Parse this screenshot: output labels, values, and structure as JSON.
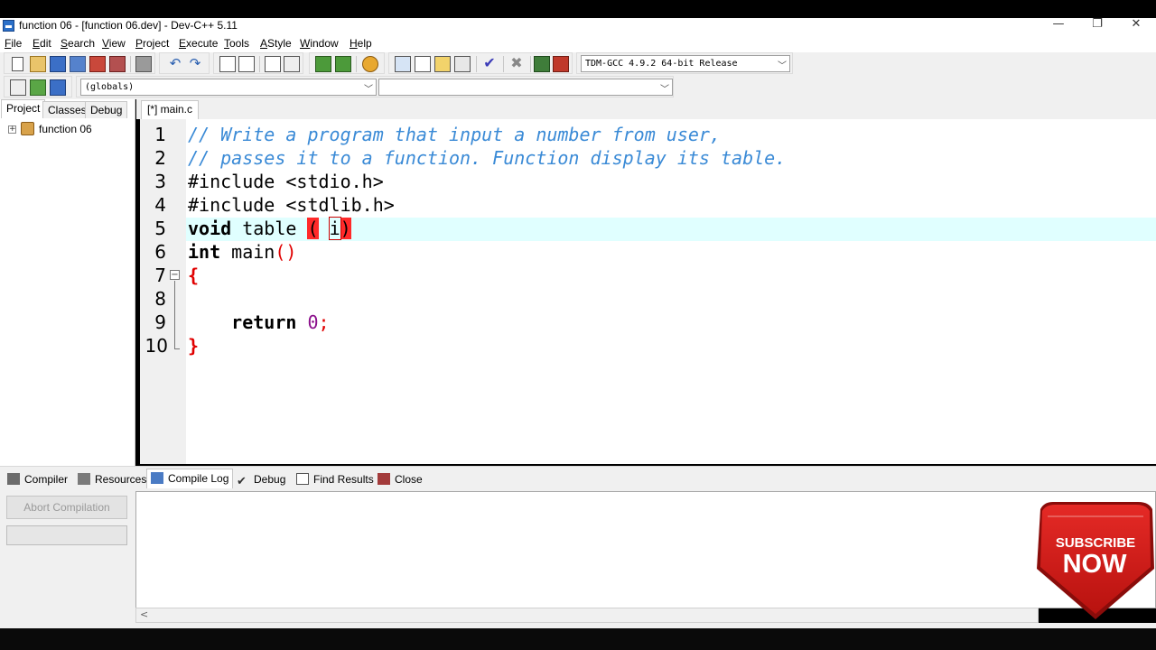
{
  "window": {
    "title": "function 06 - [function 06.dev] - Dev-C++ 5.11",
    "minimize": "—",
    "restore": "❐",
    "close": "✕"
  },
  "menu": [
    "File",
    "Edit",
    "Search",
    "View",
    "Project",
    "Execute",
    "Tools",
    "AStyle",
    "Window",
    "Help"
  ],
  "toolbar": {
    "compiler_select": "TDM-GCC 4.9.2 64-bit Release",
    "scope_select": "(globals)",
    "member_select": ""
  },
  "left_panel": {
    "tabs": [
      "Project",
      "Classes",
      "Debug"
    ],
    "active_tab": "Project",
    "tree_expander": "+",
    "project_name": "function 06"
  },
  "editor": {
    "tab_label": "[*] main.c",
    "line_numbers": [
      "1",
      "2",
      "3",
      "4",
      "5",
      "6",
      "7",
      "8",
      "9",
      "10"
    ],
    "fold_open": "−",
    "lines": {
      "l1": "// Write a program that input a number from user,",
      "l2": "// passes it to a function. Function display its table.",
      "l3": "#include <stdio.h>",
      "l4": "#include <stdlib.h>",
      "l5_kw": "void",
      "l5_name": " table ",
      "l5_open": "(",
      "l5_space": " ",
      "l5_arg": "i",
      "l5_close": ")",
      "l6_kw": "int",
      "l6_rest": " main",
      "l6_paren": "()",
      "l7": "{",
      "l9_indent": "    ",
      "l9_kw": "return",
      "l9_space": " ",
      "l9_num": "0",
      "l9_semi": ";",
      "l10": "}"
    }
  },
  "bottom_panel": {
    "tabs": [
      "Compiler",
      "Resources",
      "Compile Log",
      "Debug",
      "Find Results",
      "Close"
    ],
    "active_tab": "Compile Log",
    "abort_button": "Abort Compilation",
    "scroll_left": "<"
  },
  "overlay": {
    "line1": "SUBSCRIBE",
    "line2": "NOW",
    "color": "#d7201f"
  }
}
